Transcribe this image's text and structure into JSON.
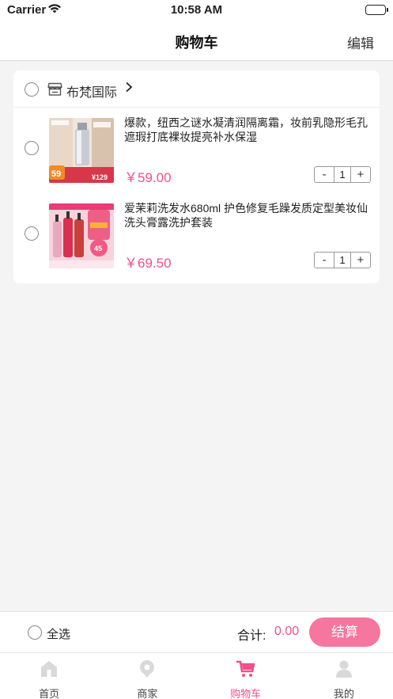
{
  "status_bar": {
    "carrier": "Carrier",
    "time": "10:58 AM"
  },
  "nav": {
    "title": "购物车",
    "edit_label": "编辑"
  },
  "store": {
    "name": "布梵国际",
    "items": [
      {
        "title": "爆款，纽西之谜水凝清润隔离霜，妆前乳隐形毛孔遮瑕打底裸妆提亮补水保湿",
        "price": "￥59.00",
        "quantity": "1",
        "thumb_badge": "59",
        "thumb_price": "¥129"
      },
      {
        "title": "爱茉莉洗发水680ml 护色修复毛躁发质定型美妆仙洗头膏露洗护套装",
        "price": "￥69.50",
        "quantity": "1",
        "thumb_badge": "45"
      }
    ]
  },
  "stepper": {
    "minus_label": "-",
    "plus_label": "+"
  },
  "checkout": {
    "select_all_label": "全选",
    "total_label": "合计:",
    "total_value": "0.00",
    "pay_label": "结算"
  },
  "tabs": [
    {
      "label": "首页",
      "icon": "home-icon",
      "active": false
    },
    {
      "label": "商家",
      "icon": "merchant-icon",
      "active": false
    },
    {
      "label": "购物车",
      "icon": "cart-icon",
      "active": true
    },
    {
      "label": "我的",
      "icon": "profile-icon",
      "active": false
    }
  ],
  "colors": {
    "accent": "#f0508a",
    "pay_button": "#f5769f",
    "background": "#f4f4f4"
  }
}
